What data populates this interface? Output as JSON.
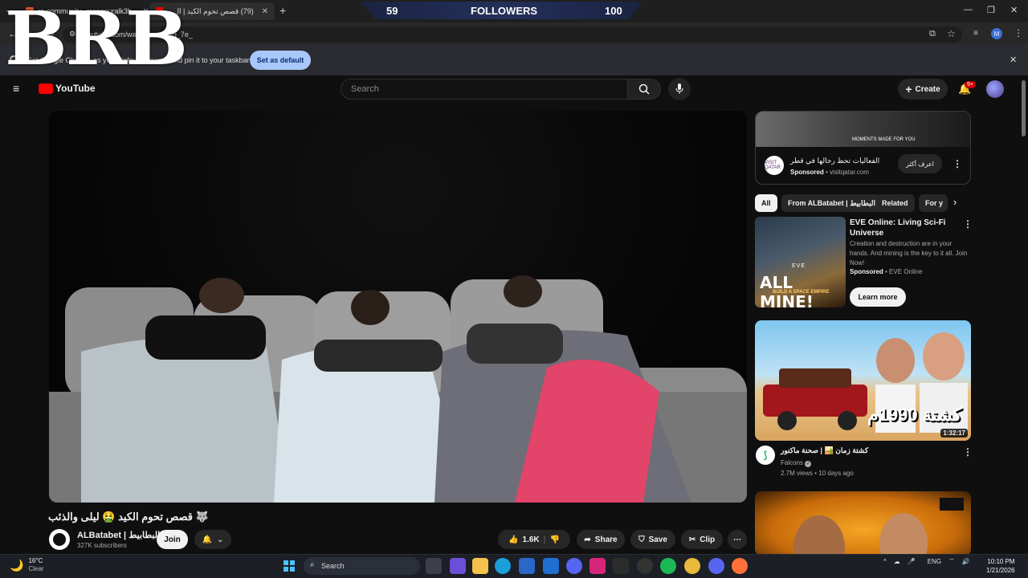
{
  "browser": {
    "tabs": [
      {
        "label": "ra-community--mansouralk3b..."
      },
      {
        "label": "(79) قصص تحوم الكيد | ال..."
      }
    ],
    "new_tab": "+",
    "url": "youtube.com/watch?v=...Beg_7e_",
    "infobar_text": "Set Google Chrome as your default browser and pin it to your taskbar",
    "set_default_label": "Set as default"
  },
  "overlay": {
    "brb": "BRB",
    "followers_left": "59",
    "followers_label": "FOLLOWERS",
    "followers_right": "100"
  },
  "youtube": {
    "logo_text": "YouTube",
    "search_placeholder": "Search",
    "create_label": "Create",
    "notif_count": "9+"
  },
  "video": {
    "title": "🐺 قصص تحوم الكيد 🤮 ليلى والذئب",
    "channel": "ALBatabet | البطابيط",
    "subscribers": "327K subscribers",
    "join": "Join",
    "likes": "1.6K",
    "share": "Share",
    "save": "Save",
    "clip": "Clip"
  },
  "sidebar": {
    "ad": {
      "banner_text": "MOMENTS MADE FOR YOU",
      "title": "الفعاليات تحط رحالها في قطر",
      "sponsored": "Sponsored",
      "domain": "visitqatar.com",
      "cta": "اعرف أكثر",
      "logo": "VISIT QATAR"
    },
    "chips": [
      "All",
      "From ALBatabet | البطابيط",
      "Related",
      "For y"
    ],
    "promo": {
      "title": "EVE Online: Living Sci-Fi Universe",
      "desc": "Creation and destruction are in your hands. And mining is the key to it all. Join Now!",
      "sponsored": "Sponsored",
      "advertiser": "EVE Online",
      "cta": "Learn more",
      "thumb_big": "ALL MINE!",
      "thumb_small": "BUILD A SPACE EMPIRE",
      "thumb_logo": "EVE"
    },
    "video1": {
      "title": "كشتة زمان 🏜️ | صحنة ماكنور",
      "channel": "Falcons",
      "meta": "2.7M views • 10 days ago",
      "duration": "1:32:17",
      "thumb_text": "كشتة 1990م"
    }
  },
  "taskbar": {
    "weather_temp": "16°C",
    "weather_desc": "Clear",
    "search": "Search",
    "lang": "ENG",
    "time": "10:10 PM",
    "date": "1/21/2026"
  }
}
